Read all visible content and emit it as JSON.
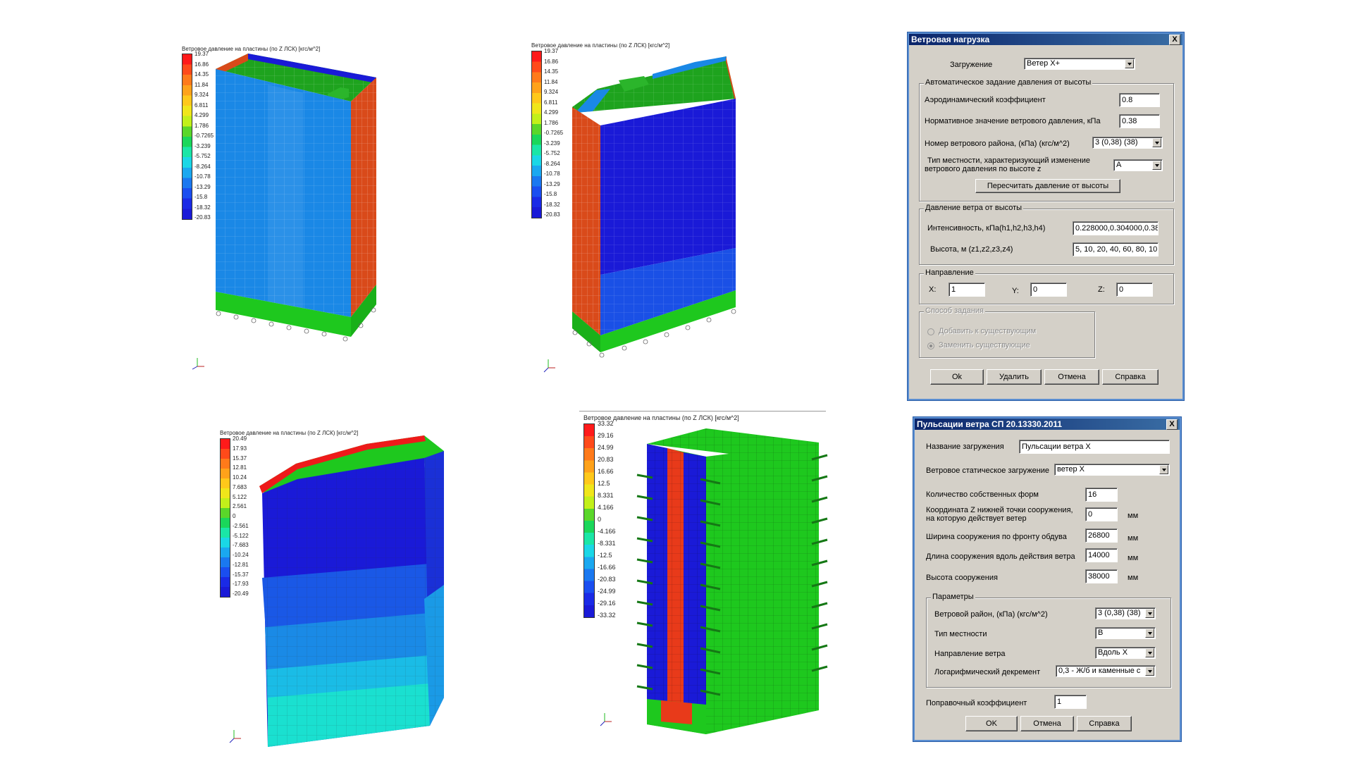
{
  "viz1": {
    "legend_title": "Ветровое давление на пластины (по Z ЛСК) [кгс/м^2]",
    "legend_values": [
      "19.37",
      "16.86",
      "14.35",
      "11.84",
      "9.324",
      "6.811",
      "4.299",
      "1.786",
      "-0.7265",
      "-3.239",
      "-5.752",
      "-8.264",
      "-10.78",
      "-13.29",
      "-15.8",
      "-18.32",
      "-20.83"
    ]
  },
  "viz2": {
    "legend_title": "Ветровое давление на пластины (по Z ЛСК) [кгс/м^2]",
    "legend_values": [
      "19.37",
      "16.86",
      "14.35",
      "11.84",
      "9.324",
      "6.811",
      "4.299",
      "1.786",
      "-0.7265",
      "-3.239",
      "-5.752",
      "-8.264",
      "-10.78",
      "-13.29",
      "-15.8",
      "-18.32",
      "-20.83"
    ]
  },
  "viz3": {
    "legend_title": "Ветровое давление на пластины (по Z ЛСК) [кгс/м^2]",
    "legend_values": [
      "20.49",
      "17.93",
      "15.37",
      "12.81",
      "10.24",
      "7.683",
      "5.122",
      "2.561",
      "0",
      "-2.561",
      "-5.122",
      "-7.683",
      "-10.24",
      "-12.81",
      "-15.37",
      "-17.93",
      "-20.49"
    ]
  },
  "viz4": {
    "legend_title": "Ветровое давление на пластины (по Z ЛСК) [кгс/м^2]",
    "legend_values": [
      "33.32",
      "29.16",
      "24.99",
      "20.83",
      "16.66",
      "12.5",
      "8.331",
      "4.166",
      "0",
      "-4.166",
      "-8.331",
      "-12.5",
      "-16.66",
      "-20.83",
      "-24.99",
      "-29.16",
      "-33.32"
    ]
  },
  "legend_colors": [
    "#ff1a1a",
    "#ff4a1a",
    "#ff7a1a",
    "#ffa21a",
    "#ffc81a",
    "#f0e61a",
    "#c2f01a",
    "#5ad72a",
    "#1ad75a",
    "#1ae6a6",
    "#1ad7e6",
    "#1aa8f0",
    "#1a78f0",
    "#1a4ef0",
    "#1a2ae6",
    "#1a1ad7"
  ],
  "dialog1": {
    "title": "Ветровая нагрузка",
    "close": "X",
    "load_label": "Загружение",
    "load_value": "Ветер X+",
    "group_auto": "Автоматическое задание давления от высоты",
    "aero_label": "Аэродинамический коэффициент",
    "aero_value": "0.8",
    "norm_label": "Нормативное значение ветрового давления, кПа",
    "norm_value": "0.38",
    "region_label": "Номер ветрового района, (кПа) (кгс/м^2)",
    "region_value": "3 (0,38) (38)",
    "terrain_label_1": "Тип местности, характеризующий изменение",
    "terrain_label_2": "ветрового давления по высоте z",
    "terrain_value": "A",
    "recalc_button": "Пересчитать давление от высоты",
    "group_pressure": "Давление ветра от высоты",
    "intensity_label": "Интенсивность, кПа(h1,h2,h3,h4)",
    "intensity_value": "0.228000,0.304000,0.38",
    "height_label": "Высота, м (z1,z2,z3,z4)",
    "height_value": "5, 10, 20, 40, 60, 80, 10",
    "group_direction": "Направление",
    "x_label": "X:",
    "x_value": "1",
    "y_label": "Y:",
    "y_value": "0",
    "z_label": "Z:",
    "z_value": "0",
    "group_method": "Способ задания",
    "radio_add": "Добавить к существующим",
    "radio_replace": "Заменить существующие",
    "ok_button": "Ok",
    "delete_button": "Удалить",
    "cancel_button": "Отмена",
    "help_button": "Справка"
  },
  "dialog2": {
    "title": "Пульсации ветра СП 20.13330.2011",
    "close": "X",
    "name_label": "Название загружения",
    "name_value": "Пульсации ветра X",
    "static_label": "Ветровое статическое загружение",
    "static_value": "ветер X",
    "modes_label": "Количество собственных форм",
    "modes_value": "16",
    "zcoord_label_1": "Координата Z нижней точки сооружения,",
    "zcoord_label_2": "на которую действует ветер",
    "zcoord_value": "0",
    "unit_mm": "мм",
    "width_label": "Ширина сооружения по фронту обдува",
    "width_value": "26800",
    "length_label": "Длина сооружения вдоль действия ветра",
    "length_value": "14000",
    "heightb_label": "Высота сооружения",
    "heightb_value": "38000",
    "group_params": "Параметры",
    "wind_region_label": "Ветровой район, (кПа) (кгс/м^2)",
    "wind_region_value": "3 (0,38) (38)",
    "terrain_label": "Тип местности",
    "terrain_value": "B",
    "direction_label": "Направление ветра",
    "direction_value": "Вдоль X",
    "decrement_label": "Логарифмический декремент",
    "decrement_value": "0,3 - Ж/б и каменные с",
    "factor_label": "Поправочный коэффициент",
    "factor_value": "1",
    "ok_button": "OK",
    "cancel_button": "Отмена",
    "help_button": "Справка"
  }
}
